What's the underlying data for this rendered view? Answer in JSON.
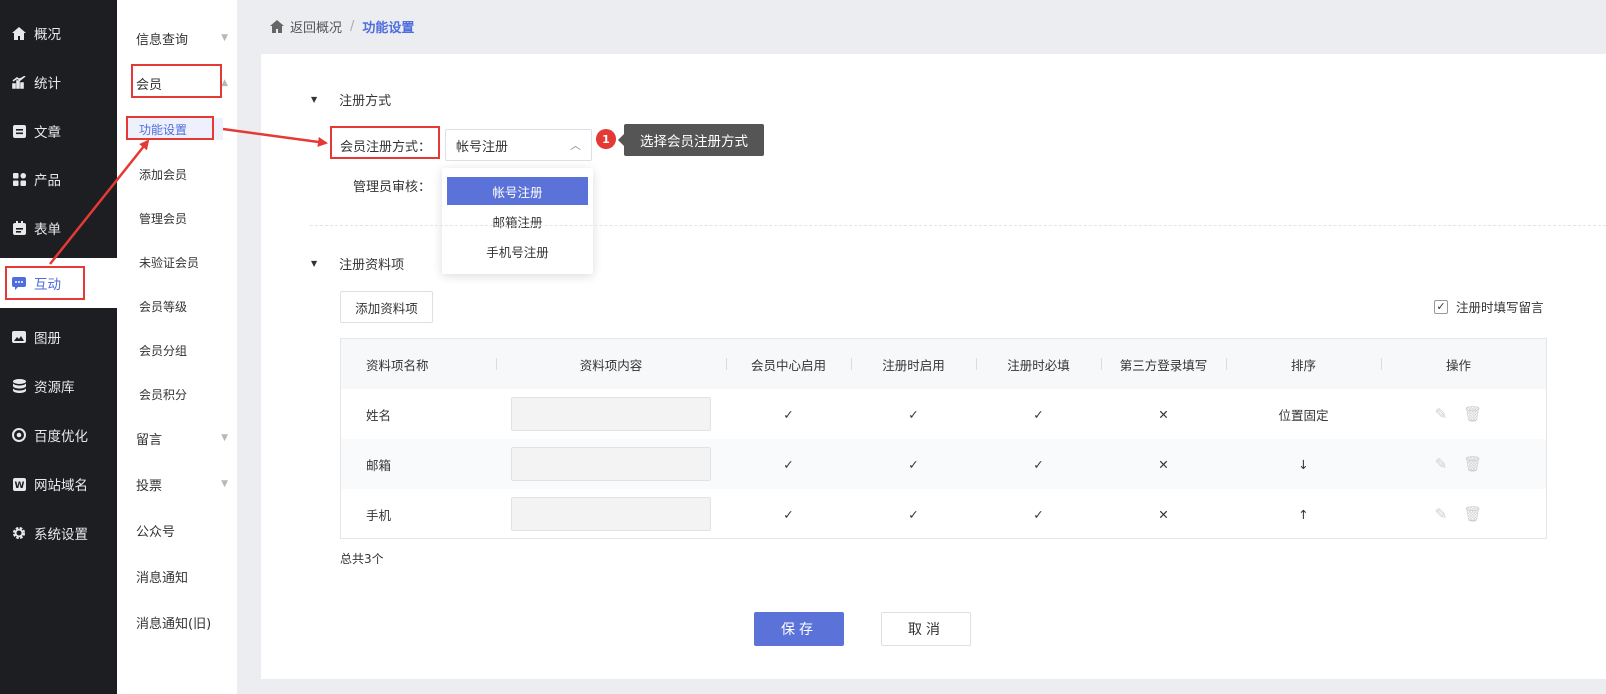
{
  "nav": {
    "items": [
      {
        "label": "概况",
        "icon": "home-icon"
      },
      {
        "label": "统计",
        "icon": "stats-icon"
      },
      {
        "label": "文章",
        "icon": "article-icon"
      },
      {
        "label": "产品",
        "icon": "product-icon"
      },
      {
        "label": "表单",
        "icon": "form-icon"
      },
      {
        "label": "互动",
        "icon": "chat-icon"
      },
      {
        "label": "图册",
        "icon": "gallery-icon"
      },
      {
        "label": "资源库",
        "icon": "database-icon"
      },
      {
        "label": "百度优化",
        "icon": "seo-icon"
      },
      {
        "label": "网站域名",
        "icon": "domain-icon"
      },
      {
        "label": "系统设置",
        "icon": "gear-icon"
      }
    ],
    "active": "互动"
  },
  "submenu": {
    "info_query": "信息查询",
    "member": "会员",
    "member_items": [
      "功能设置",
      "添加会员",
      "管理会员",
      "未验证会员",
      "会员等级",
      "会员分组",
      "会员积分"
    ],
    "message": "留言",
    "vote": "投票",
    "public_account": "公众号",
    "notification": "消息通知",
    "notification_old": "消息通知(旧)"
  },
  "breadcrumb": {
    "back": "返回概况",
    "separator": "/",
    "current": "功能设置"
  },
  "registration": {
    "section_title": "注册方式",
    "method_label": "会员注册方式：",
    "method_value": "帐号注册",
    "admin_review_label": "管理员审核：",
    "options": [
      "帐号注册",
      "邮箱注册",
      "手机号注册"
    ],
    "selected_option": "帐号注册",
    "callout_number": "1",
    "callout_text": "选择会员注册方式"
  },
  "fields": {
    "section_title": "注册资料项",
    "add_button": "添加资料项",
    "leave_message_label": "注册时填写留言",
    "leave_message_checked": true,
    "headers": [
      "资料项名称",
      "资料项内容",
      "会员中心启用",
      "注册时启用",
      "注册时必填",
      "第三方登录填写",
      "排序",
      "操作"
    ],
    "rows": [
      {
        "name": "姓名",
        "center": true,
        "reg_enable": true,
        "reg_required": true,
        "third_party": false,
        "sort": "位置固定"
      },
      {
        "name": "邮箱",
        "center": true,
        "reg_enable": true,
        "reg_required": true,
        "third_party": false,
        "sort": "↓"
      },
      {
        "name": "手机",
        "center": true,
        "reg_enable": true,
        "reg_required": true,
        "third_party": false,
        "sort": "↑"
      }
    ],
    "total": "总共3个"
  },
  "actions": {
    "save": "保存",
    "cancel": "取消"
  },
  "colors": {
    "accent": "#5b73d8",
    "annotation": "#e53935",
    "check": "#5cb85c",
    "cross": "#e53935",
    "nav_bg": "#1d1e21"
  }
}
